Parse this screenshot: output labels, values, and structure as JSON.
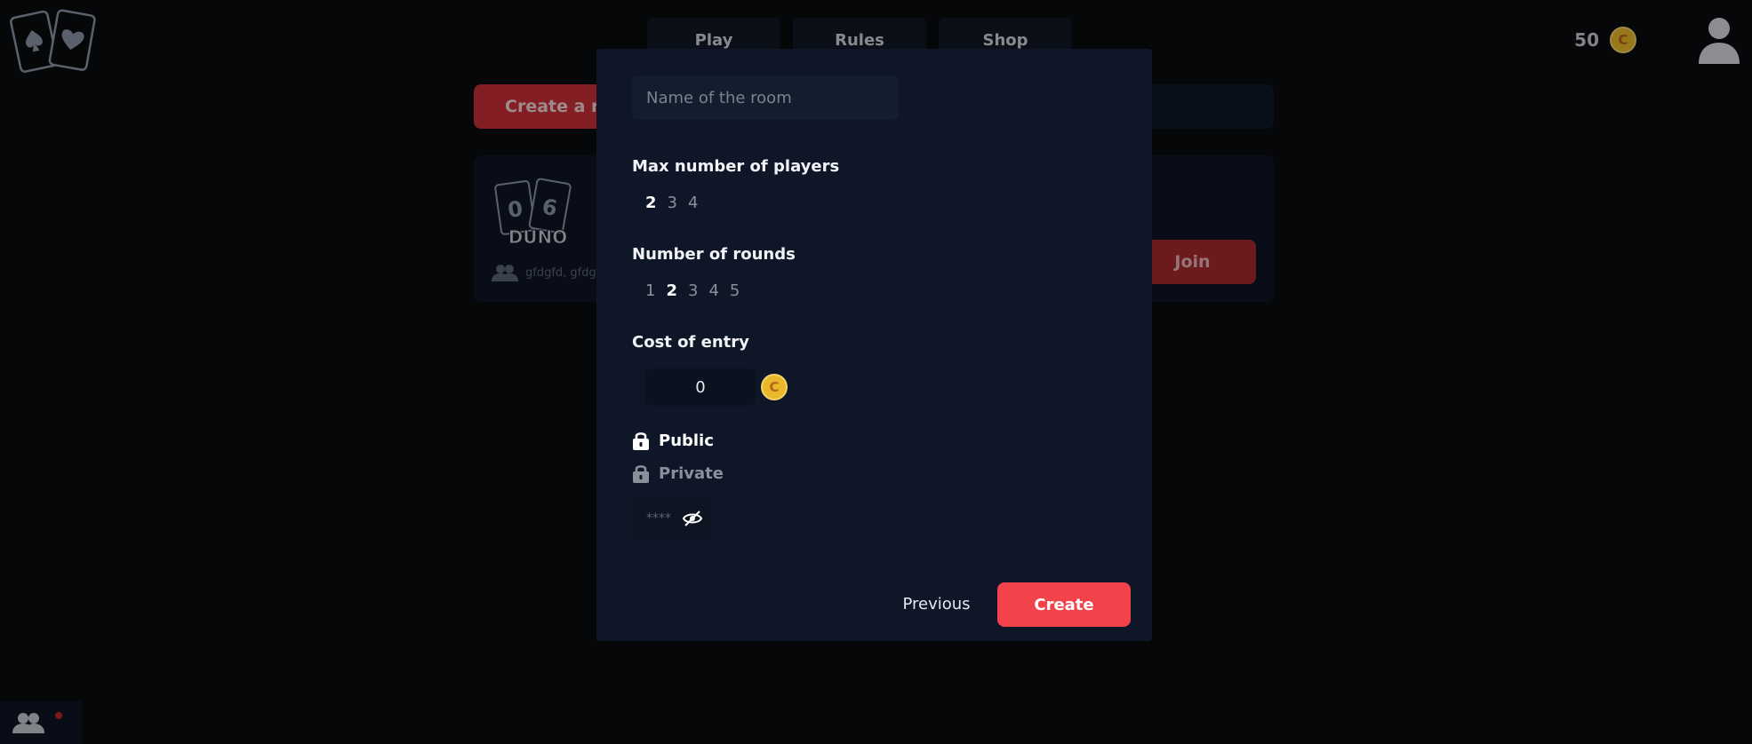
{
  "nav": {
    "items": [
      {
        "label": "Play"
      },
      {
        "label": "Rules"
      },
      {
        "label": "Shop"
      }
    ]
  },
  "wallet": {
    "balance": "50",
    "coin_symbol": "C"
  },
  "lobby": {
    "create_room_label": "Create a roo",
    "room": {
      "logo_text": "DUNO",
      "card_left": "0",
      "card_right": "6",
      "players": "gfdgfd, gfdgf"
    },
    "join_label": "Join"
  },
  "modal": {
    "room_name_placeholder": "Name of the room",
    "max_players": {
      "label": "Max number of players",
      "options": [
        "2",
        "3",
        "4"
      ],
      "selected": "2"
    },
    "rounds": {
      "label": "Number of rounds",
      "options": [
        "1",
        "2",
        "3",
        "4",
        "5"
      ],
      "selected": "2"
    },
    "cost": {
      "label": "Cost of entry",
      "value": "0",
      "coin_symbol": "C"
    },
    "visibility": {
      "public_label": "Public",
      "private_label": "Private",
      "selected": "Public"
    },
    "password_placeholder": "****",
    "previous_label": "Previous",
    "create_label": "Create"
  },
  "colors": {
    "background": "#0a0b0e",
    "modal": "#0e1628",
    "accent": "#f2434b",
    "coin": "#e8b82a"
  },
  "icons": [
    "cards-logo-icon",
    "coin-icon",
    "user-avatar-icon",
    "people-icon",
    "lock-icon",
    "eye-off-icon"
  ]
}
